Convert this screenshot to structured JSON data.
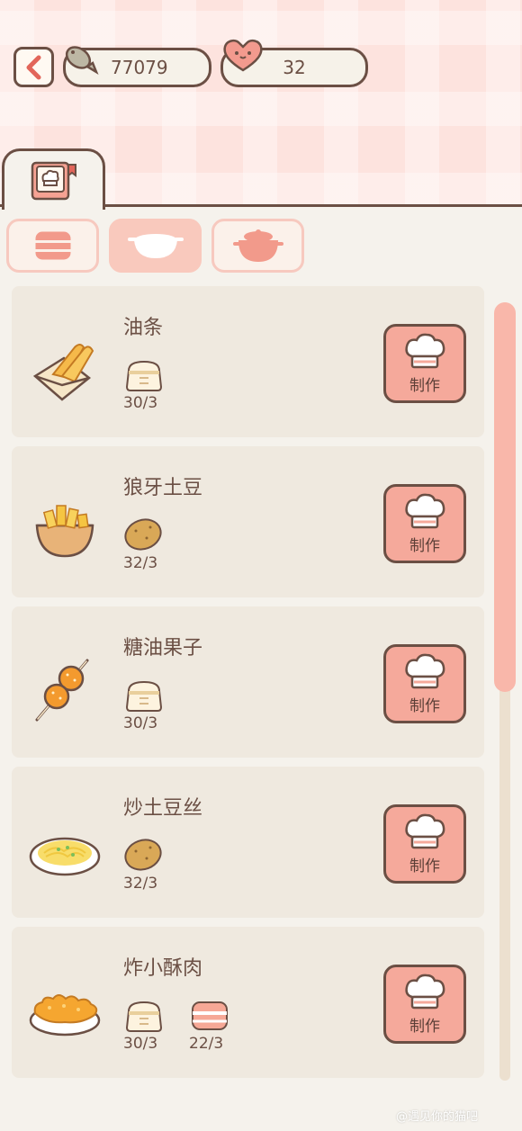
{
  "header": {
    "coins": "77079",
    "hearts": "32"
  },
  "categories": [
    {
      "name": "steamer",
      "active": false
    },
    {
      "name": "bowl",
      "active": true
    },
    {
      "name": "pot",
      "active": false
    }
  ],
  "make_label": "制作",
  "recipes": [
    {
      "name": "油条",
      "icon": "youtiao-icon",
      "ingredients": [
        {
          "icon": "flour-bag-icon",
          "count": "30/3"
        }
      ]
    },
    {
      "name": "狼牙土豆",
      "icon": "fried-potato-icon",
      "ingredients": [
        {
          "icon": "potato-icon",
          "count": "32/3"
        }
      ]
    },
    {
      "name": "糖油果子",
      "icon": "sugar-balls-icon",
      "ingredients": [
        {
          "icon": "flour-bag-icon",
          "count": "30/3"
        }
      ]
    },
    {
      "name": "炒土豆丝",
      "icon": "shredded-potato-icon",
      "ingredients": [
        {
          "icon": "potato-icon",
          "count": "32/3"
        }
      ]
    },
    {
      "name": "炸小酥肉",
      "icon": "crispy-pork-icon",
      "ingredients": [
        {
          "icon": "flour-bag-icon",
          "count": "30/3"
        },
        {
          "icon": "pork-icon",
          "count": "22/3"
        }
      ]
    }
  ],
  "watermark": "@遇见你的猫吧",
  "colors": {
    "accent": "#f5a99b",
    "outline": "#6b4f44",
    "card": "#efe9df",
    "background": "#f5f2ec"
  }
}
